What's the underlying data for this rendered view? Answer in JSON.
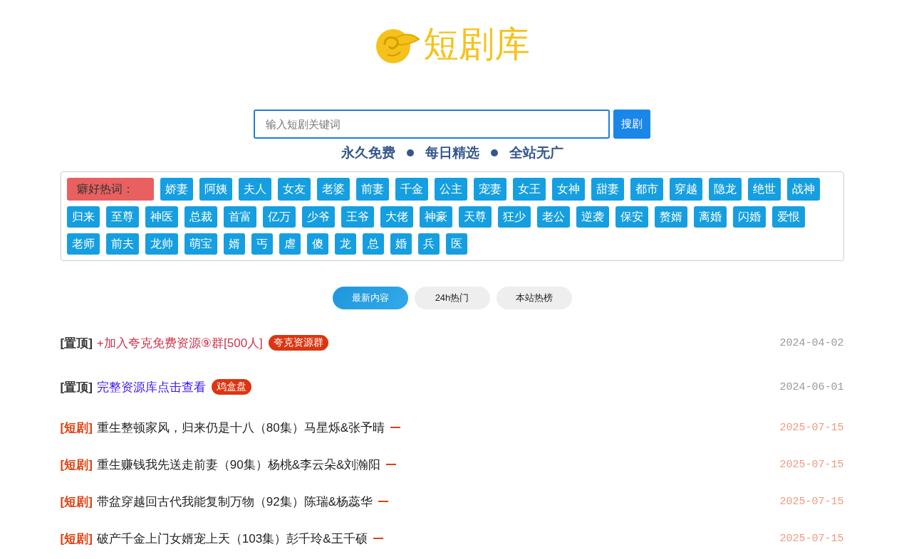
{
  "logo": {
    "text": "短剧库"
  },
  "search": {
    "placeholder": "输入短剧关键词",
    "button": "搜剧"
  },
  "mottos": [
    "永久免费",
    "每日精选",
    "全站无广"
  ],
  "hot_tags": {
    "label": "癖好热词：",
    "tags": [
      "娇妻",
      "阿姨",
      "夫人",
      "女友",
      "老婆",
      "前妻",
      "千金",
      "公主",
      "宠妻",
      "女王",
      "女神",
      "甜妻",
      "都市",
      "穿越",
      "隐龙",
      "绝世",
      "战神",
      "归来",
      "至尊",
      "神医",
      "总裁",
      "首富",
      "亿万",
      "少爷",
      "王爷",
      "大佬",
      "神豪",
      "天尊",
      "狂少",
      "老公",
      "逆袭",
      "保安",
      "赘婿",
      "离婚",
      "闪婚",
      "爱恨",
      "老师",
      "前夫",
      "龙帅",
      "萌宝",
      "婿",
      "丐",
      "虐",
      "傻",
      "龙",
      "总",
      "婚",
      "兵",
      "医"
    ]
  },
  "tabs": [
    {
      "label": "最新内容",
      "selected": true
    },
    {
      "label": "24h热门",
      "selected": false
    },
    {
      "label": "本站热榜",
      "selected": false
    }
  ],
  "posts": [
    {
      "kind": "pinned",
      "prefix": "[置顶]",
      "title": "+加入夸克免费资源⑨群[500人]",
      "color": "#d0304a",
      "badge": "夸克资源群",
      "date": "2024-04-02"
    },
    {
      "kind": "pinned",
      "prefix": "[置顶]",
      "title": "完整资源库点击查看",
      "color": "#3b10f0",
      "badge": "鸡盒盘",
      "date": "2024-06-01"
    },
    {
      "kind": "drama",
      "prefix": "[短剧]",
      "title": "重生整顿家风，归来仍是十八（80集）马星烁&张予晴",
      "date": "2025-07-15"
    },
    {
      "kind": "drama",
      "prefix": "[短剧]",
      "title": "重生赚钱我先送走前妻（90集）杨桃&李云朵&刘瀚阳",
      "date": "2025-07-15"
    },
    {
      "kind": "drama",
      "prefix": "[短剧]",
      "title": "带盆穿越回古代我能复制万物（92集）陈瑞&杨蕊华",
      "date": "2025-07-15"
    },
    {
      "kind": "drama",
      "prefix": "[短剧]",
      "title": "破产千金上门女婿宠上天（103集）彭千玲&王千硕",
      "date": "2025-07-15"
    }
  ]
}
